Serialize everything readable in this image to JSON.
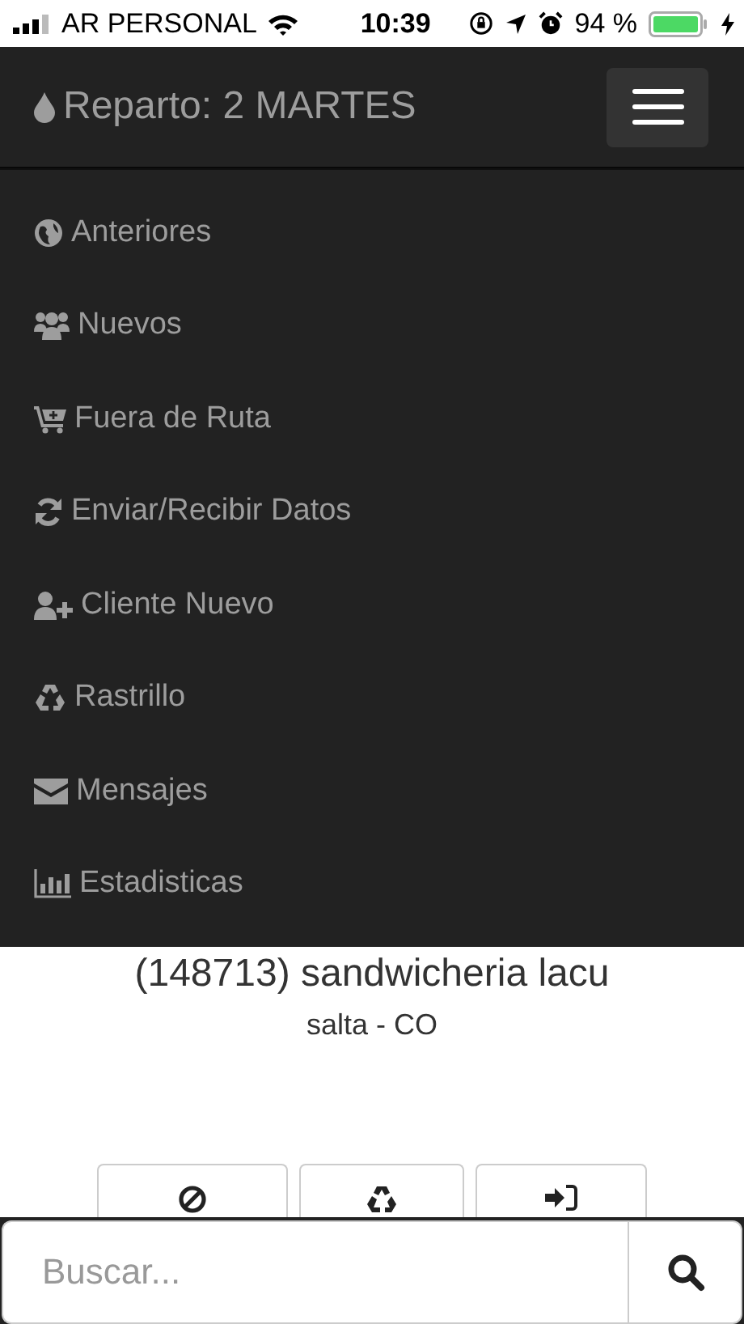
{
  "status_bar": {
    "carrier": "AR PERSONAL",
    "time": "10:39",
    "battery": "94 %"
  },
  "navbar": {
    "title": "Reparto: 2 MARTES"
  },
  "menu": {
    "items": [
      {
        "label": "Anteriores"
      },
      {
        "label": "Nuevos"
      },
      {
        "label": "Fuera de Ruta"
      },
      {
        "label": "Enviar/Recibir Datos"
      },
      {
        "label": "Cliente Nuevo"
      },
      {
        "label": "Rastrillo"
      },
      {
        "label": "Mensajes"
      },
      {
        "label": "Estadisticas"
      }
    ]
  },
  "client": {
    "title": "(148713) sandwicheria lacu",
    "subtitle": "salta - CO"
  },
  "search": {
    "placeholder": "Buscar..."
  }
}
